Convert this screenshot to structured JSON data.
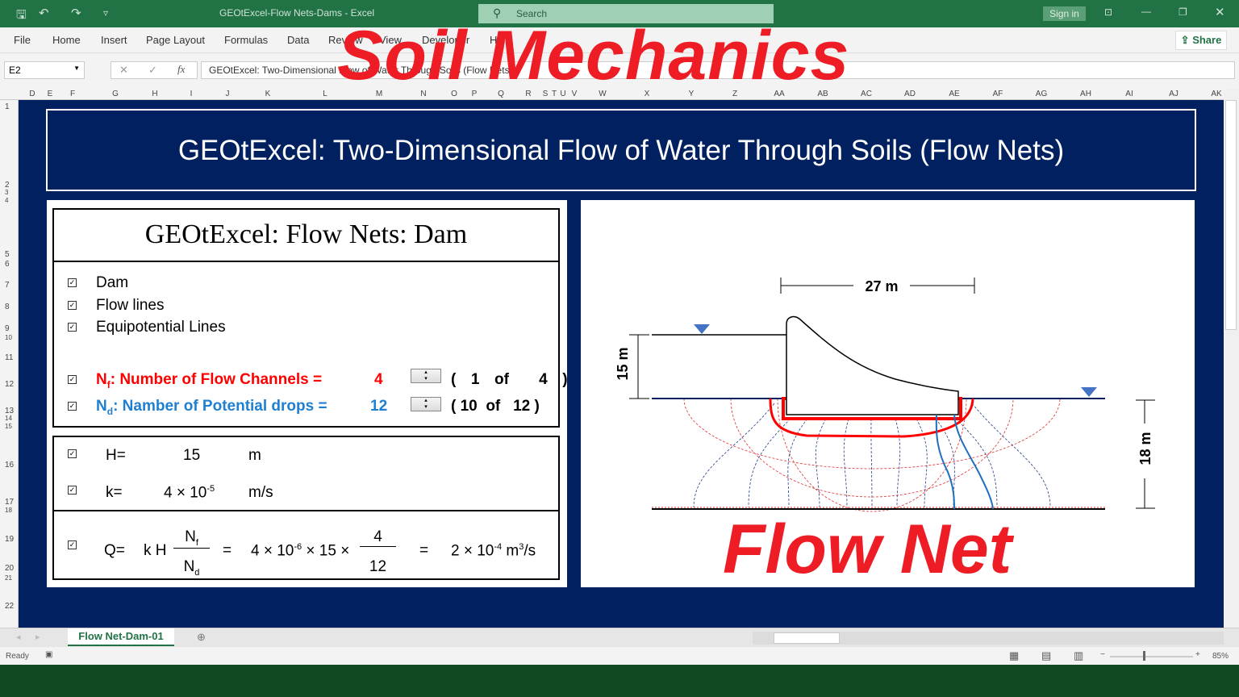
{
  "app": {
    "title": "GEOtExcel-Flow Nets-Dams  -  Excel",
    "search_placeholder": "Search",
    "sign_in": "Sign in",
    "share": "Share"
  },
  "ribbon_tabs": [
    "File",
    "Home",
    "Insert",
    "Page Layout",
    "Formulas",
    "Data",
    "Review",
    "View",
    "Developer",
    "Help"
  ],
  "formula_bar": {
    "name_box": "E2",
    "formula": "GEOtExcel: Two-Dimensional Flow of Water Through Soils (Flow Nets)"
  },
  "columns": [
    "D",
    "E",
    "F",
    "G",
    "H",
    "I",
    "J",
    "K",
    "L",
    "M",
    "N",
    "O",
    "P",
    "Q",
    "R",
    "S",
    "T",
    "U",
    "V",
    "W",
    "X",
    "Y",
    "Z",
    "AA",
    "AB",
    "AC",
    "AD",
    "AE",
    "AF",
    "AG",
    "AH",
    "AI",
    "AJ",
    "AK"
  ],
  "rows": [
    "1",
    "2",
    "3",
    "4",
    "5",
    "6",
    "7",
    "8",
    "9",
    "10",
    "11",
    "12",
    "13",
    "14",
    "15",
    "16",
    "17",
    "18",
    "19",
    "20",
    "21",
    "22"
  ],
  "overlay": {
    "top": "Soil Mechanics",
    "bottom": "Flow Net"
  },
  "banner": "GEOtExcel: Two-Dimensional Flow of Water Through Soils (Flow Nets)",
  "panel": {
    "title": "GEOtExcel: Flow Nets: Dam",
    "checks": [
      "Dam",
      "Flow lines",
      "Equipotential Lines"
    ],
    "nf": {
      "sym": "N",
      "sub": "f",
      "label": ": Number of Flow Channels  =",
      "value": "4",
      "open": "(",
      "cur": "1",
      "of": "of",
      "total": "4",
      "close": ")"
    },
    "nd": {
      "sym": "N",
      "sub": "d",
      "label": ": Namber of Potential drops =",
      "value": "12",
      "open": "(",
      "cur": "10",
      "of": "of",
      "total": "12",
      "close": ")"
    },
    "H": {
      "label": "H=",
      "value": "15",
      "unit": "m"
    },
    "k": {
      "label": "k=",
      "value": "4 × 10",
      "exp": "-5",
      "unit": "m/s"
    },
    "Q": {
      "label": "Q=",
      "expr": "k H",
      "num": "N",
      "num_sub": "f",
      "den": "N",
      "den_sub": "d",
      "eq": "=",
      "k": "4 × 10",
      "k_exp": "-6",
      "mid": "× 15 ×",
      "fnum": "4",
      "fden": "12",
      "eq2": "=",
      "res": "2 × 10",
      "res_exp": "-4",
      "unit": "m",
      "unit_exp": "3",
      "unit_tail": "/s"
    }
  },
  "diagram": {
    "width_label": "27 m",
    "head_label": "15 m",
    "depth_label": "18 m",
    "colors": {
      "flow": "#1f6fbf",
      "equip": "#e03030",
      "outline": "#ff0000"
    }
  },
  "sheet_tab": "Flow Net-Dam-01",
  "status": {
    "ready": "Ready",
    "zoom": "85%"
  }
}
